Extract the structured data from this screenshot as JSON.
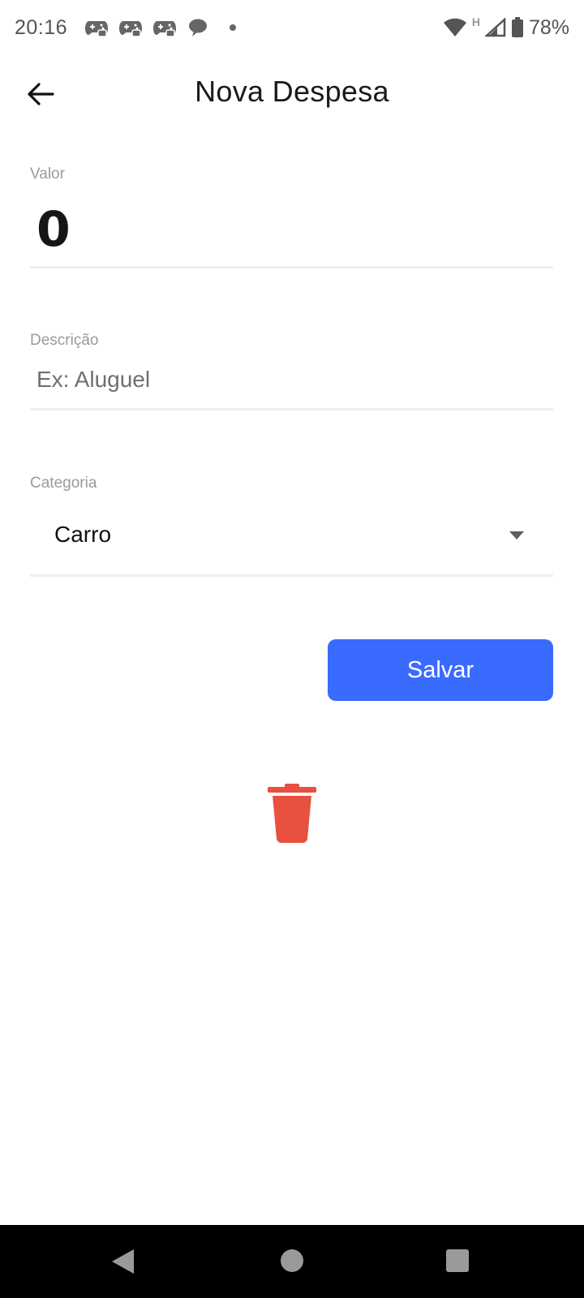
{
  "status_bar": {
    "time": "20:16",
    "network_type": "H",
    "battery": "78%",
    "notification_icons": [
      "game-controller-icon",
      "game-controller-icon",
      "game-controller-icon",
      "chat-bubble-icon",
      "more-notifications-dot-icon"
    ],
    "system_icons": [
      "wifi-icon",
      "cell-signal-icon",
      "battery-icon"
    ]
  },
  "app_bar": {
    "title": "Nova Despesa",
    "back_icon": "arrow-left-icon"
  },
  "form": {
    "valor": {
      "label": "Valor",
      "value": "0"
    },
    "descricao": {
      "label": "Descrição",
      "value": "",
      "placeholder": "Ex: Aluguel"
    },
    "categoria": {
      "label": "Categoria",
      "selected": "Carro",
      "icon": "dropdown-arrow-icon"
    }
  },
  "actions": {
    "save_label": "Salvar",
    "delete_icon": "trash-icon"
  },
  "colors": {
    "primary": "#3a6bff",
    "danger": "#e8513f",
    "label": "#9a9a9a",
    "underline": "#eeeeee"
  },
  "nav_bar": {
    "buttons": [
      "back-triangle-icon",
      "home-circle-icon",
      "recents-square-icon"
    ]
  }
}
